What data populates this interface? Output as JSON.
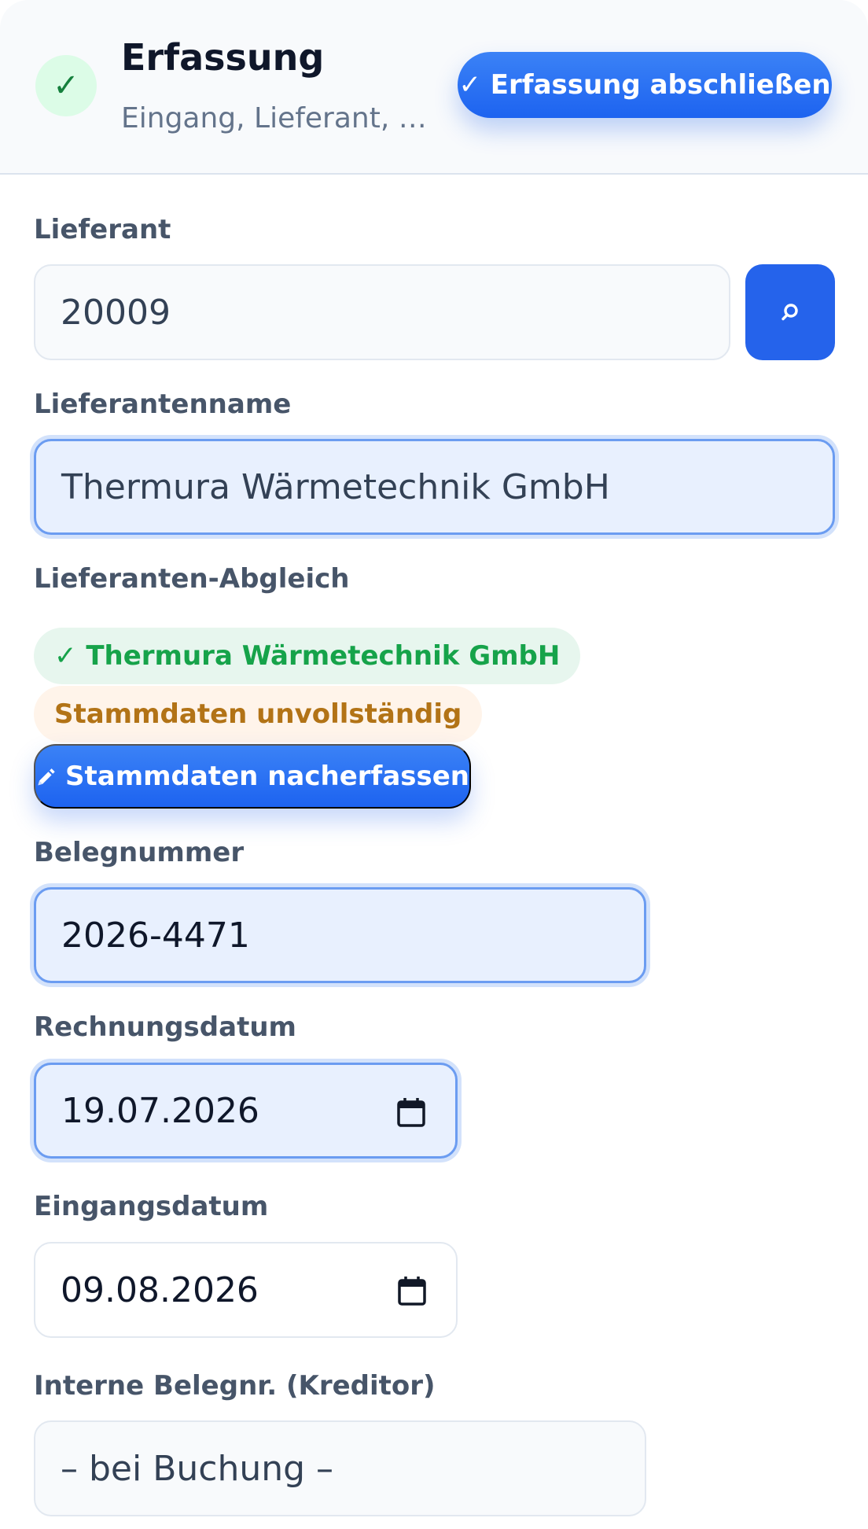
{
  "header": {
    "title": "Erfassung",
    "subtitle": "Eingang, Lieferant, B…",
    "check_glyph": "✓",
    "complete_button": "✓ Erfassung abschließen"
  },
  "form": {
    "supplier": {
      "label": "Lieferant",
      "value": "20009",
      "search_icon": "search-icon"
    },
    "supplier_name": {
      "label": "Lieferantenname",
      "value": "Thermura Wärmetechnik GmbH"
    },
    "matching": {
      "label": "Lieferanten-Abgleich",
      "match_pill": "✓ Thermura Wärmetechnik GmbH",
      "warning_pill": "Stammdaten unvollständig",
      "edit_button": "Stammdaten nacherfassen",
      "edit_icon": "pencil-icon"
    },
    "doc_number": {
      "label": "Belegnummer",
      "value": "2026-4471"
    },
    "invoice_date": {
      "label": "Rechnungsdatum",
      "value": "19.07.2026"
    },
    "receipt_date": {
      "label": "Eingangsdatum",
      "value": "09.08.2026"
    },
    "internal_number": {
      "label": "Interne Belegnr. (Kreditor)",
      "value": "– bei Buchung –"
    }
  },
  "colors": {
    "accent": "#2563eb",
    "success": "#16a34a",
    "warning": "#b27316",
    "focus_bg": "#e8f0fe"
  }
}
